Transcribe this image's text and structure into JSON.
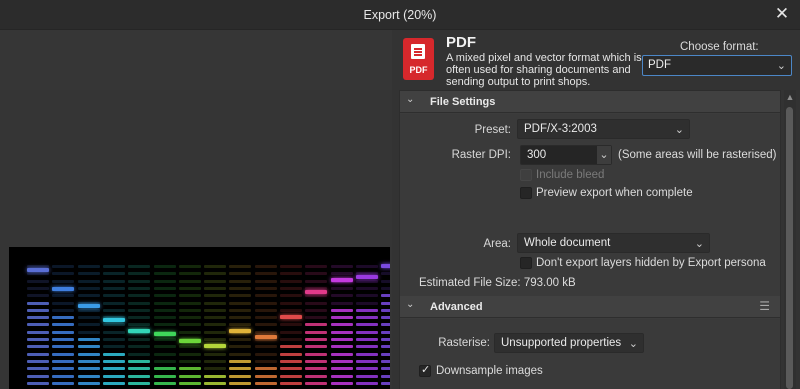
{
  "window": {
    "title": "Export (20%)"
  },
  "format": {
    "icon_label": "PDF",
    "name": "PDF",
    "description": "A mixed pixel and vector format which is often used for sharing documents and sending output to print shops.",
    "choose_label": "Choose format:",
    "selected": "PDF"
  },
  "file_settings": {
    "title": "File Settings",
    "preset_label": "Preset:",
    "preset_value": "PDF/X-3:2003",
    "raster_dpi_label": "Raster DPI:",
    "raster_dpi_value": "300",
    "raster_dpi_note": "(Some areas will be rasterised)",
    "include_bleed_label": "Include bleed",
    "preview_export_label": "Preview export when complete",
    "area_label": "Area:",
    "area_value": "Whole document",
    "dont_export_hidden_label": "Don't export layers hidden by Export persona",
    "estimated_size_label": "Estimated File Size:",
    "estimated_size_value": "793.00 kB"
  },
  "advanced": {
    "title": "Advanced",
    "rasterise_label": "Rasterise:",
    "rasterise_value": "Unsupported properties",
    "downsample_label": "Downsample images"
  },
  "icons": {
    "close": "close-icon",
    "chevron": "chevron-down-icon",
    "menu": "hamburger-menu-icon"
  },
  "preview_equalizer": {
    "colors": [
      "#5a6fd6",
      "#3f7fe0",
      "#3a9ce8",
      "#33c7e0",
      "#33d6b8",
      "#3fd65a",
      "#6cd63a",
      "#b4d63a",
      "#e0b43a",
      "#e07a3a",
      "#e04a4a",
      "#e03a8a",
      "#c43ae0",
      "#9a3ae0",
      "#7a4ae0"
    ],
    "peaks": [
      0.85,
      0.72,
      0.6,
      0.5,
      0.42,
      0.4,
      0.35,
      0.32,
      0.42,
      0.38,
      0.52,
      0.7,
      0.78,
      0.8,
      0.88
    ]
  }
}
